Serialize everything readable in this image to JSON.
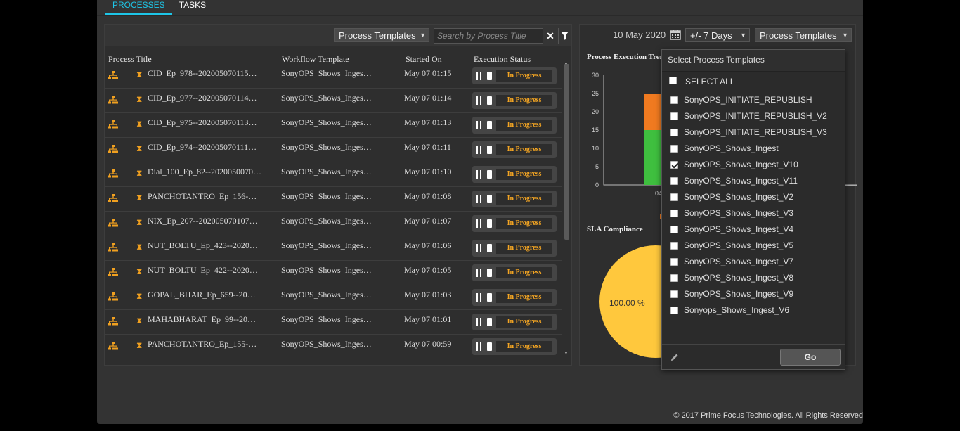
{
  "tabs": [
    {
      "label": "PROCESSES",
      "active": true
    },
    {
      "label": "TASKS",
      "active": false
    }
  ],
  "left_toolbar": {
    "templates_dropdown": "Process Templates",
    "search_placeholder": "Search by Process Title"
  },
  "table": {
    "headers": [
      "Process Title",
      "Workflow Template",
      "Started On",
      "Execution Status"
    ],
    "rows": [
      {
        "title": "CID_Ep_978--202005070115…",
        "template": "SonyOPS_Shows_Inges…",
        "started": "May 07 01:15",
        "status": "In Progress"
      },
      {
        "title": "CID_Ep_977--202005070114…",
        "template": "SonyOPS_Shows_Inges…",
        "started": "May 07 01:14",
        "status": "In Progress"
      },
      {
        "title": "CID_Ep_975--202005070113…",
        "template": "SonyOPS_Shows_Inges…",
        "started": "May 07 01:13",
        "status": "In Progress"
      },
      {
        "title": "CID_Ep_974--202005070111…",
        "template": "SonyOPS_Shows_Inges…",
        "started": "May 07 01:11",
        "status": "In Progress"
      },
      {
        "title": "Dial_100_Ep_82--2020050070…",
        "template": "SonyOPS_Shows_Inges…",
        "started": "May 07 01:10",
        "status": "In Progress"
      },
      {
        "title": "PANCHOTANTRO_Ep_156-…",
        "template": "SonyOPS_Shows_Inges…",
        "started": "May 07 01:08",
        "status": "In Progress"
      },
      {
        "title": "NIX_Ep_207--202005070107…",
        "template": "SonyOPS_Shows_Inges…",
        "started": "May 07 01:07",
        "status": "In Progress"
      },
      {
        "title": "NUT_BOLTU_Ep_423--2020…",
        "template": "SonyOPS_Shows_Inges…",
        "started": "May 07 01:06",
        "status": "In Progress"
      },
      {
        "title": "NUT_BOLTU_Ep_422--2020…",
        "template": "SonyOPS_Shows_Inges…",
        "started": "May 07 01:05",
        "status": "In Progress"
      },
      {
        "title": "GOPAL_BHAR_Ep_659--20…",
        "template": "SonyOPS_Shows_Inges…",
        "started": "May 07 01:03",
        "status": "In Progress"
      },
      {
        "title": "MAHABHARAT_Ep_99--20…",
        "template": "SonyOPS_Shows_Inges…",
        "started": "May 07 01:01",
        "status": "In Progress"
      },
      {
        "title": "PANCHOTANTRO_Ep_155-…",
        "template": "SonyOPS_Shows_Inges…",
        "started": "May 07 00:59",
        "status": "In Progress"
      }
    ]
  },
  "right_toolbar": {
    "date": "10 May 2020",
    "range": "+/- 7 Days",
    "templates_dropdown": "Process Templates"
  },
  "trend_chart": {
    "title": "Process Execution Tren",
    "y_ticks": [
      "30",
      "25",
      "20",
      "15",
      "10",
      "5",
      "0"
    ],
    "x_label_partial": "04"
  },
  "chart_data": {
    "type": "bar",
    "title": "Process Execution Tren",
    "ylim": [
      0,
      30
    ],
    "categories": [
      "04"
    ],
    "series": [
      {
        "values": [
          15
        ],
        "color": "#3fbf3f"
      },
      {
        "values": [
          10
        ],
        "color": "#f07a20"
      }
    ]
  },
  "sla": {
    "title": "SLA Compliance",
    "value_label": "100.00 %",
    "color": "#ffc83d"
  },
  "popup": {
    "title": "Select Process Templates",
    "select_all": "SELECT ALL",
    "options": [
      {
        "label": "SonyOPS_INITIATE_REPUBLISH",
        "checked": false
      },
      {
        "label": "SonyOPS_INITIATE_REPUBLISH_V2",
        "checked": false
      },
      {
        "label": "SonyOPS_INITIATE_REPUBLISH_V3",
        "checked": false
      },
      {
        "label": "SonyOPS_Shows_Ingest",
        "checked": false
      },
      {
        "label": "SonyOPS_Shows_Ingest_V10",
        "checked": true
      },
      {
        "label": "SonyOPS_Shows_Ingest_V11",
        "checked": false
      },
      {
        "label": "SonyOPS_Shows_Ingest_V2",
        "checked": false
      },
      {
        "label": "SonyOPS_Shows_Ingest_V3",
        "checked": false
      },
      {
        "label": "SonyOPS_Shows_Ingest_V4",
        "checked": false
      },
      {
        "label": "SonyOPS_Shows_Ingest_V5",
        "checked": false
      },
      {
        "label": "SonyOPS_Shows_Ingest_V7",
        "checked": false
      },
      {
        "label": "SonyOPS_Shows_Ingest_V8",
        "checked": false
      },
      {
        "label": "SonyOPS_Shows_Ingest_V9",
        "checked": false
      },
      {
        "label": "Sonyops_Shows_Ingest_V6",
        "checked": false
      }
    ],
    "go_label": "Go"
  },
  "footer": "© 2017 Prime Focus Technologies. All Rights Reserved",
  "colors": {
    "accent": "#1ec6e8",
    "status": "#f5a623",
    "icon": "#f0a020"
  }
}
